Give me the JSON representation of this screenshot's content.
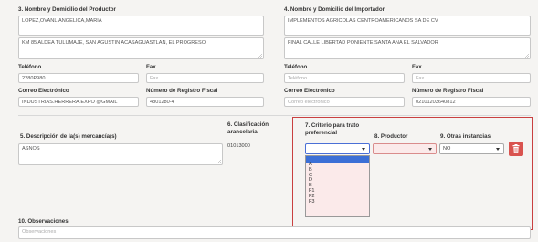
{
  "producer": {
    "section_title": "3. Nombre y Domicilio del Productor",
    "name": "LOPEZ,OVANL,ANGELICA,MARIA",
    "address": "KM 85 ALDEA TULUMAJE, SAN AGUSTIN ACASAGUASTLAN, EL PROGRESO",
    "phone_label": "Teléfono",
    "phone_value": "2280P980",
    "fax_label": "Fax",
    "fax_placeholder": "Fax",
    "email_label": "Correo Electrónico",
    "email_value": "INDUSTRIAS.HERRERA.EXPO @GMAIL",
    "tax_label": "Número de Registro Fiscal",
    "tax_value": "4801280-4"
  },
  "importer": {
    "section_title": "4. Nombre y Domicilio del Importador",
    "name": "IMPLEMENTOS AGRICOLAS CENTROAMERICANOS SA DE CV",
    "address": "FINAL CALLE LIBERTAD PONIENTE SANTA ANA EL SALVADOR",
    "phone_label": "Teléfono",
    "phone_placeholder": "Teléfono",
    "fax_label": "Fax",
    "fax_placeholder": "Fax",
    "email_label": "Correo Electrónico",
    "email_placeholder": "Correo electrónico",
    "tax_label": "Número de Registro Fiscal",
    "tax_value": "02101203640812"
  },
  "goods": {
    "desc_label": "5. Descripción de la(s) mercancía(s)",
    "desc_value": "ASNOS",
    "tariff_label_1": "6. Clasificación",
    "tariff_label_2": "arancelaria",
    "tariff_value": "01013000",
    "criterion_label_1": "7. Criterio para trato",
    "criterion_label_2": "preferencial",
    "criterion_options": [
      "",
      "A",
      "B",
      "C",
      "D",
      "E",
      "F1",
      "F2",
      "F3"
    ],
    "producer_label": "8. Productor",
    "other_label": "9. Otras instancias",
    "other_value": "NO"
  },
  "observations": {
    "label": "10. Observaciones",
    "placeholder": "Observaciones"
  },
  "colors": {
    "highlight_border": "#c94040",
    "delete_button": "#d9534f",
    "dropdown_selected": "#3b6fd6"
  },
  "icons": {
    "delete": "trash-icon"
  }
}
